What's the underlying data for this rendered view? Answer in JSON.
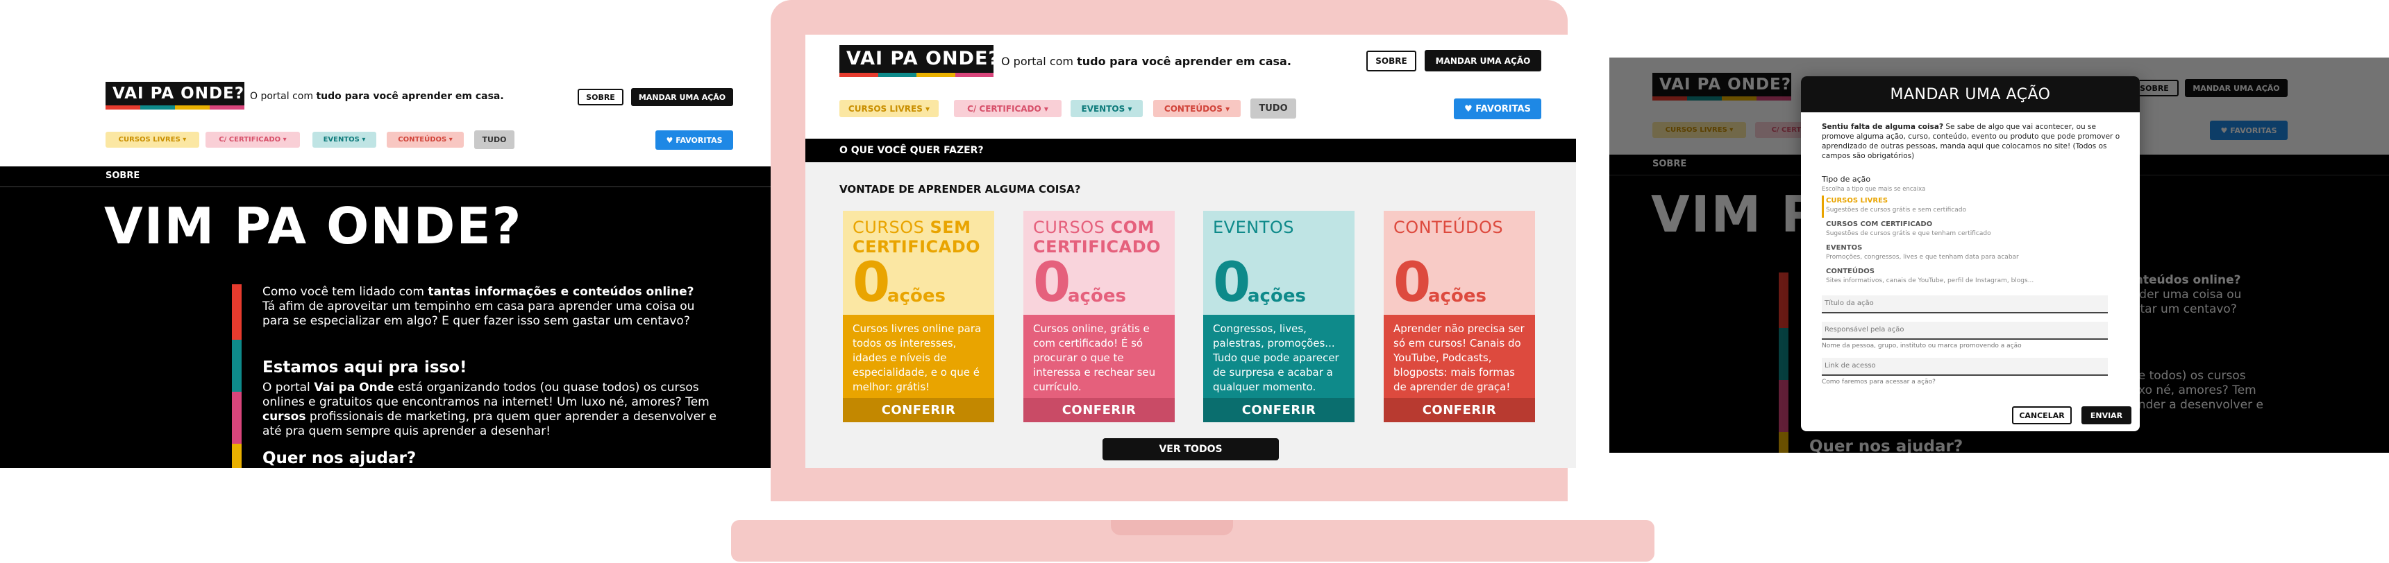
{
  "brand": {
    "logo": "VAI PA ONDE?",
    "tagline_prefix": "O portal com",
    "tagline_bold": "tudo para você aprender em casa.",
    "stripe_colors": [
      "#e63b2e",
      "#0e8a8a",
      "#e9b000",
      "#d8457b"
    ]
  },
  "header": {
    "about_label": "SOBRE",
    "submit_action_label": "MANDAR UMA AÇÃO",
    "favorites_label": "FAVORITAS",
    "favorites_icon": "heart-icon"
  },
  "filters": [
    {
      "label": "CURSOS LIVRES",
      "bg": "#fbe7a3",
      "fg": "#c98f00",
      "dropdown": true
    },
    {
      "label": "C/ CERTIFICADO",
      "bg": "#f9cfd6",
      "fg": "#d7506a",
      "dropdown": true
    },
    {
      "label": "EVENTOS",
      "bg": "#bfe4e4",
      "fg": "#0e7b7b",
      "dropdown": true
    },
    {
      "label": "CONTEÚDOS",
      "bg": "#f8c7c2",
      "fg": "#d1443a",
      "dropdown": true
    },
    {
      "label": "TUDO",
      "bg": "#c9c9c9",
      "fg": "#333333",
      "dropdown": false
    }
  ],
  "about_page": {
    "section_label": "SOBRE",
    "title": "VIM PA ONDE?",
    "p1_a": "Como você tem lidado com ",
    "p1_b": "tantas informações e conteúdos online?",
    "p1_c": "Tá afim de aproveitar um tempinho em casa para aprender uma coisa ou para se especializar em algo? E quer fazer isso sem gastar um centavo?",
    "h2": "Estamos aqui pra isso!",
    "p2_a": "O portal ",
    "p2_b": "Vai pa Onde",
    "p2_c": " está organizando todos (ou quase todos) os cursos onlines e gratuitos que encontramos na internet! Um luxo né, amores? Tem ",
    "p2_d": "cursos",
    "p2_e": " profissionais de marketing, pra quem quer aprender a desenvolver e até pra quem sempre quis aprender a desenhar!",
    "h3": "Quer nos ajudar?"
  },
  "home": {
    "banner": "O QUE VOCÊ QUER FAZER?",
    "question": "VONTADE DE APRENDER ALGUMA COISA?",
    "unit": "ações",
    "cta": "CONFERIR",
    "see_all": "VER TODOS",
    "cards": [
      {
        "title_a": "CURSOS ",
        "title_b": "SEM",
        "title_c": "CERTIFICADO",
        "count": "0",
        "top": "#fbe7a3",
        "fg": "#e9a400",
        "bottom": "#e9a400",
        "cta_bg": "#c38800",
        "desc": "Cursos livres online para todos os interesses, idades e níveis de especialidade, e o que é melhor: grátis!"
      },
      {
        "title_a": "CURSOS ",
        "title_b": "COM",
        "title_c": "CERTIFICADO",
        "count": "0",
        "top": "#f9d4dc",
        "fg": "#e5607c",
        "bottom": "#e5607c",
        "cta_bg": "#c94b66",
        "desc": "Cursos online, grátis e com certificado! É só procurar o que te interessa e rechear seu currículo."
      },
      {
        "title_a": "EVENTOS",
        "title_b": "",
        "title_c": "",
        "count": "0",
        "top": "#bfe4e4",
        "fg": "#0e8a8a",
        "bottom": "#0e8a8a",
        "cta_bg": "#0a6e6e",
        "desc": "Congressos, lives, palestras, promoções... Tudo que pode aparecer de surpresa e acabar a qualquer momento."
      },
      {
        "title_a": "CONTEÚDOS",
        "title_b": "",
        "title_c": "",
        "count": "0",
        "top": "#f8cbc6",
        "fg": "#dd4a3e",
        "bottom": "#dd4a3e",
        "cta_bg": "#b83a30",
        "desc": "Aprender não precisa ser só em cursos! Canais do YouTube, Podcasts, blogposts: mais formas de aprender de graça!"
      }
    ]
  },
  "modal": {
    "title": "MANDAR UMA AÇÃO",
    "intro_bold": "Sentiu falta de alguma coisa?",
    "intro": " Se sabe de algo que vai acontecer, ou se promove alguma ação, curso, conteúdo, evento ou produto que pode promover o aprendizado de outras pessoas, manda aqui que colocamos no site! (Todos os campos são obrigatórios)",
    "type_label": "Tipo de ação",
    "type_help": "Escolha a tipo que mais se encaixa",
    "options": [
      {
        "title": "CURSOS LIVRES",
        "desc": "Sugestões de cursos grátis e sem certificado",
        "selected": true
      },
      {
        "title": "CURSOS COM CERTIFICADO",
        "desc": "Sugestões de cursos grátis e que tenham certificado",
        "selected": false
      },
      {
        "title": "EVENTOS",
        "desc": "Promoções, congressos, lives e que tenham data para acabar",
        "selected": false
      },
      {
        "title": "CONTEÚDOS",
        "desc": "Sites informativos, canais de YouTube, perfil de Instagram, blogs...",
        "selected": false
      }
    ],
    "field_title": "Título da ação",
    "field_owner": "Responsável pela ação",
    "field_owner_help": "Nome da pessoa, grupo, instituto ou marca promovendo a ação",
    "field_link": "Link de acesso",
    "field_link_help": "Como faremos para acessar a ação?",
    "cancel": "CANCELAR",
    "send": "ENVIAR"
  }
}
